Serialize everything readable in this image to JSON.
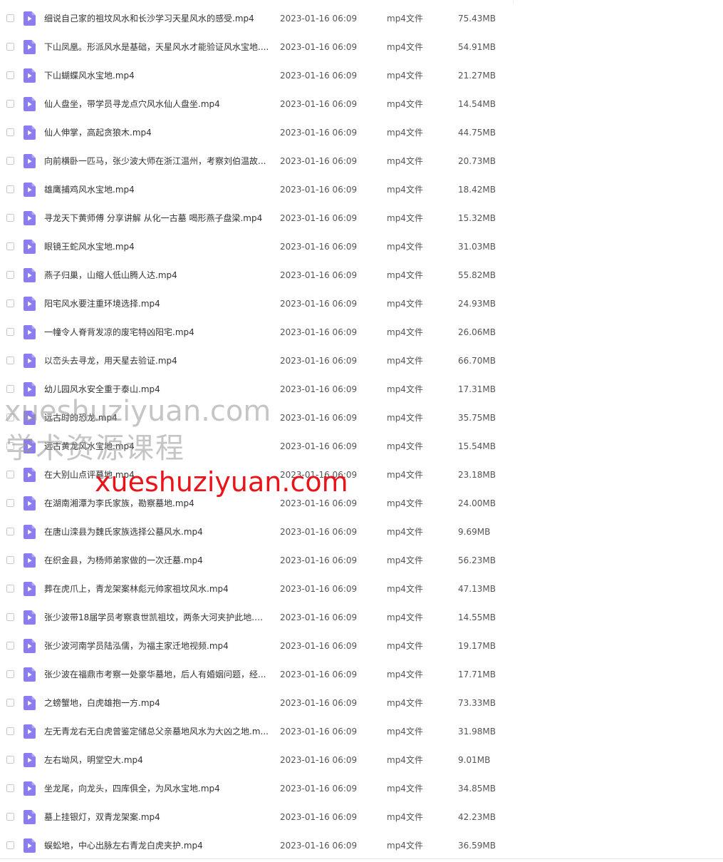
{
  "colors": {
    "icon_purple": "#8b7cf0",
    "icon_purple_light": "#b3a8f7",
    "watermark_red": "#e8141a",
    "watermark_gray": "#969696"
  },
  "row_icon": "video-file-icon",
  "files": [
    {
      "name": "细说自己家的祖坟风水和长沙学习天星风水的感受.mp4",
      "date": "2023-01-16 06:09",
      "type": "mp4文件",
      "size": "75.43MB"
    },
    {
      "name": "下山凤凰。形派风水是基础，天星风水才能验证风水宝地....",
      "date": "2023-01-16 06:09",
      "type": "mp4文件",
      "size": "54.91MB"
    },
    {
      "name": "下山蝴蝶风水宝地.mp4",
      "date": "2023-01-16 06:09",
      "type": "mp4文件",
      "size": "21.27MB"
    },
    {
      "name": "仙人盘坐，带学员寻龙点穴风水仙人盘坐.mp4",
      "date": "2023-01-16 06:09",
      "type": "mp4文件",
      "size": "14.54MB"
    },
    {
      "name": "仙人伸掌，高起贪狼木.mp4",
      "date": "2023-01-16 06:09",
      "type": "mp4文件",
      "size": "44.75MB"
    },
    {
      "name": "向前横卧一匹马，张少波大师在浙江温州，考察刘伯温故...",
      "date": "2023-01-16 06:09",
      "type": "mp4文件",
      "size": "20.73MB"
    },
    {
      "name": "雄鹰捕鸡风水宝地.mp4",
      "date": "2023-01-16 06:09",
      "type": "mp4文件",
      "size": "18.42MB"
    },
    {
      "name": "寻龙天下黄师傅 分享讲解 从化一古墓 喝形燕子盘梁.mp4",
      "date": "2023-01-16 06:09",
      "type": "mp4文件",
      "size": "15.32MB"
    },
    {
      "name": "眼镜王蛇风水宝地.mp4",
      "date": "2023-01-16 06:09",
      "type": "mp4文件",
      "size": "31.03MB"
    },
    {
      "name": "燕子归巢，山缩人低山腾人达.mp4",
      "date": "2023-01-16 06:09",
      "type": "mp4文件",
      "size": "55.82MB"
    },
    {
      "name": "阳宅风水要注重环境选择.mp4",
      "date": "2023-01-16 06:09",
      "type": "mp4文件",
      "size": "24.93MB"
    },
    {
      "name": "一幢令人脊背发凉的废宅特凶阳宅.mp4",
      "date": "2023-01-16 06:09",
      "type": "mp4文件",
      "size": "26.06MB"
    },
    {
      "name": "以峦头去寻龙，用天星去验证.mp4",
      "date": "2023-01-16 06:09",
      "type": "mp4文件",
      "size": "66.70MB"
    },
    {
      "name": "幼儿园风水安全重于泰山.mp4",
      "date": "2023-01-16 06:09",
      "type": "mp4文件",
      "size": "17.31MB"
    },
    {
      "name": "远古时的恐龙.mp4",
      "date": "2023-01-16 06:09",
      "type": "mp4文件",
      "size": "35.75MB"
    },
    {
      "name": "远古黄龙风水宝地.mp4",
      "date": "2023-01-16 06:09",
      "type": "mp4文件",
      "size": "15.54MB"
    },
    {
      "name": "在大别山点评墓地.mp4",
      "date": "2023-01-16 06:09",
      "type": "mp4文件",
      "size": "23.18MB"
    },
    {
      "name": "在湖南湘潭为李氏家族，勘察墓地.mp4",
      "date": "2023-01-16 06:09",
      "type": "mp4文件",
      "size": "24.00MB"
    },
    {
      "name": "在唐山滦县为魏氏家族选择公墓风水.mp4",
      "date": "2023-01-16 06:09",
      "type": "mp4文件",
      "size": "9.69MB"
    },
    {
      "name": "在织金县，为杨师弟家做的一次迁墓.mp4",
      "date": "2023-01-16 06:09",
      "type": "mp4文件",
      "size": "56.23MB"
    },
    {
      "name": "葬在虎爪上，青龙架案林彪元帅家祖坟风水.mp4",
      "date": "2023-01-16 06:09",
      "type": "mp4文件",
      "size": "47.13MB"
    },
    {
      "name": "张少波带18届学员考察袁世凯祖坟，两条大河夹护此地.m...",
      "date": "2023-01-16 06:09",
      "type": "mp4文件",
      "size": "14.55MB"
    },
    {
      "name": "张少波河南学员陆泓儒，为福主家迁地视频.mp4",
      "date": "2023-01-16 06:09",
      "type": "mp4文件",
      "size": "19.17MB"
    },
    {
      "name": "张少波在福鼎市考察一处豪华墓地，后人有婚姻问题，经...",
      "date": "2023-01-16 06:09",
      "type": "mp4文件",
      "size": "17.71MB"
    },
    {
      "name": "之螃蟹地，白虎雄抱一方.mp4",
      "date": "2023-01-16 06:09",
      "type": "mp4文件",
      "size": "73.33MB"
    },
    {
      "name": "左无青龙右无白虎曾鉴定储总父亲墓地风水为大凶之地.m...",
      "date": "2023-01-16 06:09",
      "type": "mp4文件",
      "size": "31.98MB"
    },
    {
      "name": "左右坳风，明堂空大.mp4",
      "date": "2023-01-16 06:09",
      "type": "mp4文件",
      "size": "9.01MB"
    },
    {
      "name": "坐龙尾，向龙头，四库俱全，为风水宝地.mp4",
      "date": "2023-01-16 06:09",
      "type": "mp4文件",
      "size": "34.85MB"
    },
    {
      "name": "墓上挂银灯，双青龙架案.mp4",
      "date": "2023-01-16 06:09",
      "type": "mp4文件",
      "size": "42.23MB"
    },
    {
      "name": "蜈蚣地，中心出脉左右青龙白虎夹护.mp4",
      "date": "2023-01-16 06:09",
      "type": "mp4文件",
      "size": "36.59MB"
    }
  ],
  "watermarks": {
    "gray_url": "xueshuziyuan.com",
    "gray_text": "学术资源课程",
    "red_url": "xueshuziyuan.com"
  }
}
